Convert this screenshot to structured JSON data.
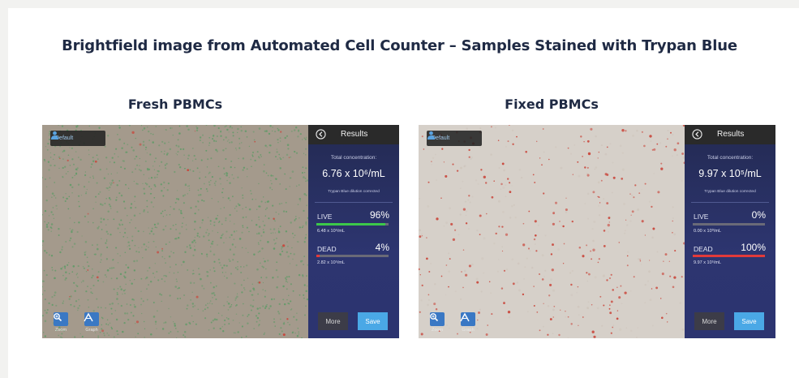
{
  "title": "Brightfield image from Automated Cell Counter – Samples Stained with Trypan Blue",
  "panels": [
    {
      "title": "Fresh PBMCs",
      "profile": "Default",
      "tools": {
        "zoom": "Zoom",
        "graph": "Graph"
      },
      "results": {
        "header": "Results",
        "total_label": "Total concentration:",
        "total_value": "6.76 x 10⁶/mL",
        "dilution_note": "Trypan Blue dilution corrected",
        "live": {
          "label": "LIVE",
          "percent": "96%",
          "fraction": 0.96,
          "concentration": "6.48 x 10⁶/mL"
        },
        "dead": {
          "label": "DEAD",
          "percent": "4%",
          "fraction": 0.04,
          "concentration": "2.82 x 10⁵/mL"
        }
      },
      "buttons": {
        "more": "More",
        "save": "Save"
      }
    },
    {
      "title": "Fixed PBMCs",
      "profile": "Default",
      "tools": {
        "zoom": "Zoom",
        "graph": "Graph"
      },
      "results": {
        "header": "Results",
        "total_label": "Total concentration:",
        "total_value": "9.97 x 10⁵/mL",
        "dilution_note": "Trypan Blue dilution corrected",
        "live": {
          "label": "LIVE",
          "percent": "0%",
          "fraction": 0.0,
          "concentration": "0.00 x 10⁰/mL"
        },
        "dead": {
          "label": "DEAD",
          "percent": "100%",
          "fraction": 1.0,
          "concentration": "9.97 x 10⁵/mL"
        }
      },
      "buttons": {
        "more": "More",
        "save": "Save"
      }
    }
  ],
  "colors": {
    "title_text": "#1f2a44",
    "live_bar": "#3cc84a",
    "dead_bar": "#e23a3a",
    "bar_track": "#6a6a78",
    "save_button": "#4aa8e6",
    "results_panel": "#2c3470",
    "fresh_field": "#a49a8c",
    "fixed_field": "#d6d0c9",
    "live_cell": "#5e9a66",
    "dead_cell": "#c9453a"
  },
  "icons": {
    "profile": "person-icon",
    "back": "back-arrow-icon",
    "zoom": "zoom-icon",
    "graph": "graph-icon"
  }
}
